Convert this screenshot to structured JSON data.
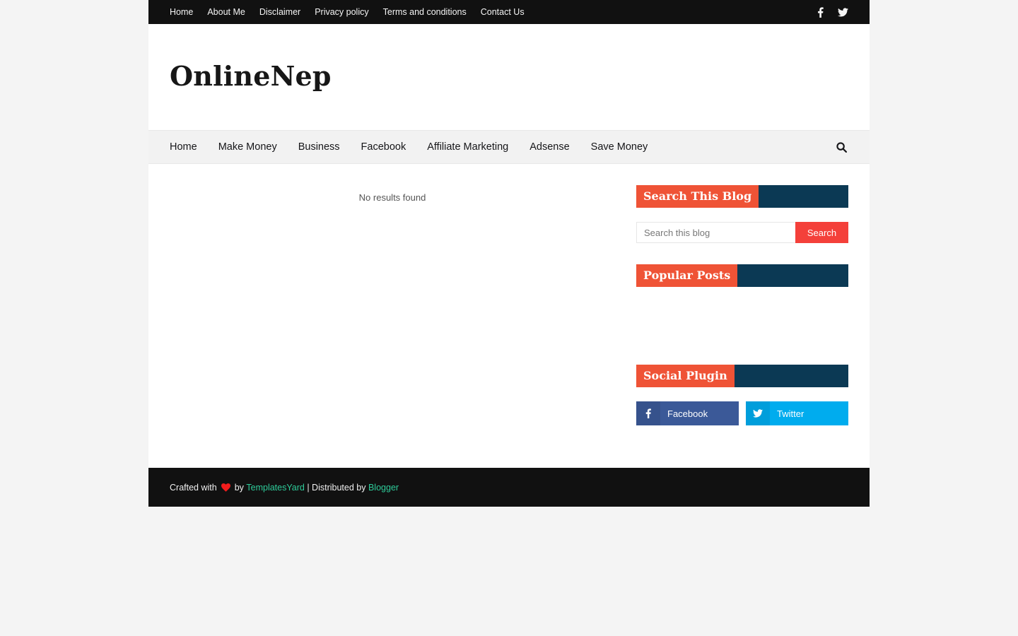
{
  "topbar": {
    "links": [
      "Home",
      "About Me",
      "Disclaimer",
      "Privacy policy",
      "Terms and conditions",
      "Contact Us"
    ],
    "social_icons": [
      "facebook-icon",
      "twitter-icon"
    ]
  },
  "header": {
    "logo": "OnlineNep"
  },
  "nav": {
    "items": [
      "Home",
      "Make Money",
      "Business",
      "Facebook",
      "Affiliate Marketing",
      "Adsense",
      "Save Money"
    ],
    "search_icon": "search-icon"
  },
  "main": {
    "no_results": "No results found"
  },
  "sidebar": {
    "search_widget": {
      "title": "Search This Blog",
      "placeholder": "Search this blog",
      "button": "Search"
    },
    "popular_widget": {
      "title": "Popular Posts"
    },
    "social_widget": {
      "title": "Social Plugin",
      "facebook_label": "Facebook",
      "twitter_label": "Twitter"
    }
  },
  "footer": {
    "crafted": "Crafted with",
    "by": "by",
    "templates_link": "TemplatesYard",
    "distributed": "| Distributed by",
    "blogger_link": "Blogger"
  },
  "colors": {
    "accent": "#ef5336",
    "widget_bar": "#0b3954",
    "facebook": "#3b5998",
    "twitter": "#00acee",
    "footer_link": "#2ecc9a"
  }
}
